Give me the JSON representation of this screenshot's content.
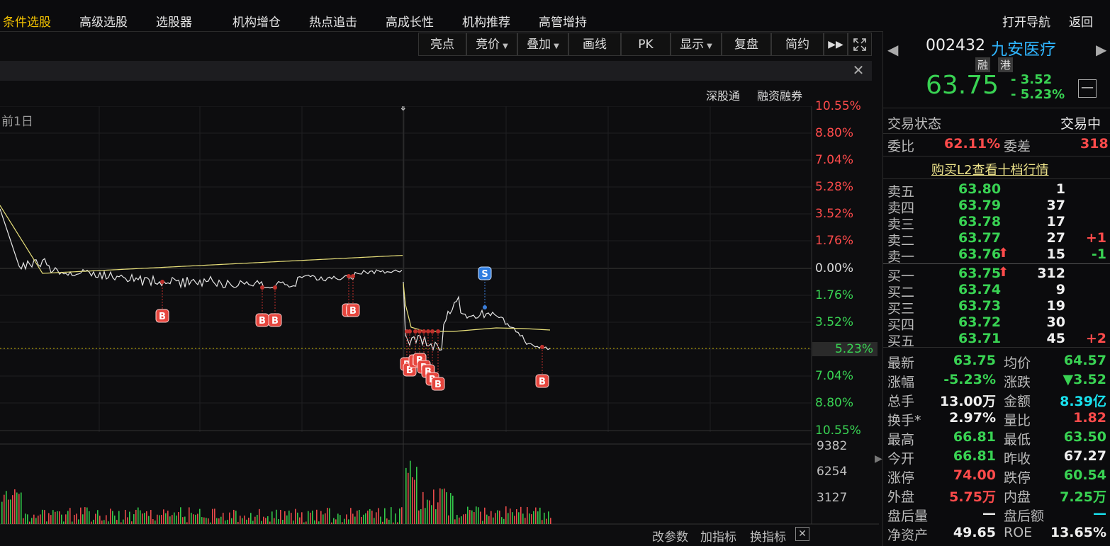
{
  "nav": {
    "items": [
      "条件选股",
      "高级选股",
      "选股器",
      "机构增仓",
      "热点追击",
      "高成长性",
      "机构推荐",
      "高管增持"
    ],
    "right_items": [
      "打开导航",
      "返回"
    ]
  },
  "toolbar": {
    "buttons": [
      "亮点",
      "竞价",
      "叠加",
      "画线",
      "PK",
      "显示",
      "复盘",
      "简约"
    ],
    "more_icon": "double-right-arrow",
    "fullscreen_icon": "expand-icon"
  },
  "chart_header": {
    "links": [
      "深股通",
      "融资融券"
    ],
    "prev_day_label": "前1日"
  },
  "chart_data": {
    "type": "line",
    "price_axis_labels": [
      {
        "text": "10.55%",
        "color": "#ff4b4b"
      },
      {
        "text": "8.80%",
        "color": "#ff4b4b"
      },
      {
        "text": "7.04%",
        "color": "#ff4b4b"
      },
      {
        "text": "5.28%",
        "color": "#ff4b4b"
      },
      {
        "text": "3.52%",
        "color": "#ff4b4b"
      },
      {
        "text": "1.76%",
        "color": "#ff4b4b"
      },
      {
        "text": "0.00%",
        "color": "#dcdcdc"
      },
      {
        "text": "1.76%",
        "color": "#39d353"
      },
      {
        "text": "3.52%",
        "color": "#39d353"
      },
      {
        "text": "5.23%",
        "color": "#39d353"
      },
      {
        "text": "7.04%",
        "color": "#39d353"
      },
      {
        "text": "8.80%",
        "color": "#39d353"
      },
      {
        "text": "10.55%",
        "color": "#39d353"
      }
    ],
    "current_change_pct": -5.23,
    "volume_axis_labels": [
      "9382",
      "6254",
      "3127"
    ],
    "ylim_pct": [
      -10.55,
      10.55
    ],
    "volume_max": 9382,
    "markers": [
      "B",
      "S"
    ]
  },
  "chart_tools": [
    "改参数",
    "加指标",
    "换指标"
  ],
  "quote": {
    "code": "002432",
    "name": "九安医疗",
    "tags": [
      "融",
      "港"
    ],
    "price": "63.75",
    "change": "- 3.52",
    "change_pct": "- 5.23%",
    "trade_status_label": "交易状态",
    "trade_status": "交易中",
    "weibi_label": "委比",
    "weibi": "62.11%",
    "weicha_label": "委差",
    "weicha": "318",
    "l2_link": "购买L2查看十档行情",
    "asks": [
      {
        "label": "卖五",
        "price": "63.80",
        "vol": "1",
        "delta": ""
      },
      {
        "label": "卖四",
        "price": "63.79",
        "vol": "37",
        "delta": ""
      },
      {
        "label": "卖三",
        "price": "63.78",
        "vol": "17",
        "delta": ""
      },
      {
        "label": "卖二",
        "price": "63.77",
        "vol": "27",
        "delta": "+1"
      },
      {
        "label": "卖一",
        "price": "63.76",
        "vol": "15",
        "delta": "-1"
      }
    ],
    "bids": [
      {
        "label": "买一",
        "price": "63.75",
        "vol": "312",
        "delta": ""
      },
      {
        "label": "买二",
        "price": "63.74",
        "vol": "9",
        "delta": ""
      },
      {
        "label": "买三",
        "price": "63.73",
        "vol": "19",
        "delta": ""
      },
      {
        "label": "买四",
        "price": "63.72",
        "vol": "30",
        "delta": ""
      },
      {
        "label": "买五",
        "price": "63.71",
        "vol": "45",
        "delta": "+2"
      }
    ],
    "stats": [
      {
        "l1": "最新",
        "v1": "63.75",
        "c1": "green",
        "l2": "均价",
        "v2": "64.57",
        "c2": "green"
      },
      {
        "l1": "涨幅",
        "v1": "-5.23%",
        "c1": "green",
        "l2": "涨跌",
        "v2": "▼3.52",
        "c2": "green"
      },
      {
        "l1": "总手",
        "v1": "13.00万",
        "c1": "white",
        "l2": "金额",
        "v2": "8.39亿",
        "c2": "cyan"
      },
      {
        "l1": "换手*",
        "v1": "2.97%",
        "c1": "white",
        "l2": "量比",
        "v2": "1.82",
        "c2": "red"
      },
      {
        "l1": "最高",
        "v1": "66.81",
        "c1": "green",
        "l2": "最低",
        "v2": "63.50",
        "c2": "green"
      },
      {
        "l1": "今开",
        "v1": "66.81",
        "c1": "green",
        "l2": "昨收",
        "v2": "67.27",
        "c2": "white"
      },
      {
        "l1": "涨停",
        "v1": "74.00",
        "c1": "red",
        "l2": "跌停",
        "v2": "60.54",
        "c2": "green"
      },
      {
        "l1": "外盘",
        "v1": "5.75万",
        "c1": "red",
        "l2": "内盘",
        "v2": "7.25万",
        "c2": "green"
      },
      {
        "l1": "盘后量",
        "v1": "—",
        "c1": "white",
        "l2": "盘后额",
        "v2": "—",
        "c2": "cyan"
      },
      {
        "l1": "净资产",
        "v1": "49.65",
        "c1": "white",
        "l2": "ROE",
        "v2": "13.65%",
        "c2": "white"
      }
    ]
  }
}
